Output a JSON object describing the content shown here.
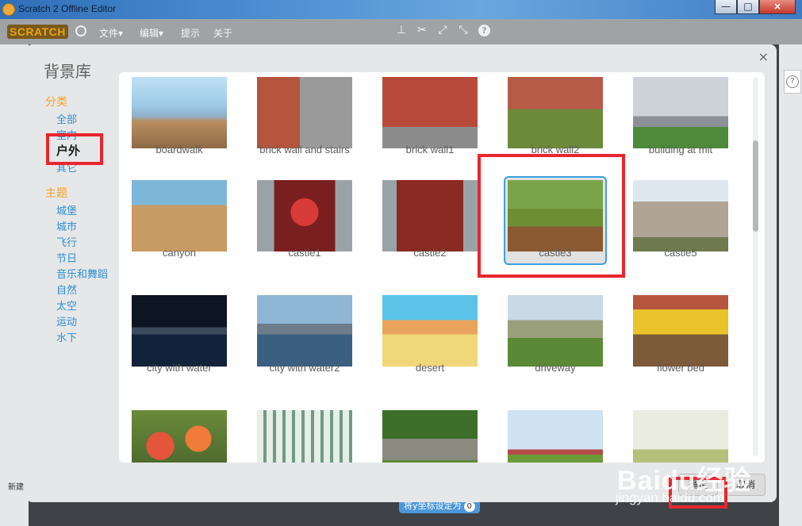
{
  "window": {
    "title": "Scratch 2 Offline Editor",
    "min": "—",
    "max": "□",
    "close": "×"
  },
  "menubar": {
    "logo": "SCRATCH",
    "items": [
      "文件▾",
      "编辑▾",
      "提示",
      "关于"
    ],
    "tools": [
      "duplicate-stamp",
      "delete-scissors",
      "grow",
      "shrink"
    ],
    "help": "?"
  },
  "dialog": {
    "title": "背景库",
    "close": "×",
    "category_header": "分类",
    "categories": [
      "全部",
      "室内",
      "户外",
      "其它"
    ],
    "theme_header": "主题",
    "themes": [
      "城堡",
      "城市",
      "飞行",
      "节日",
      "音乐和舞蹈",
      "自然",
      "太空",
      "运动",
      "水下"
    ],
    "ok": "确定",
    "cancel": "取消",
    "items": [
      {
        "label": "boardwalk"
      },
      {
        "label": "brick wall and stairs"
      },
      {
        "label": "brick wall1"
      },
      {
        "label": "brick wall2"
      },
      {
        "label": "building at mit"
      },
      {
        "label": "canyon"
      },
      {
        "label": "castle1"
      },
      {
        "label": "castle2"
      },
      {
        "label": "castle3"
      },
      {
        "label": "castle5"
      },
      {
        "label": "city with water"
      },
      {
        "label": "city with water2"
      },
      {
        "label": "desert"
      },
      {
        "label": "driveway"
      },
      {
        "label": "flower bed"
      },
      {
        "label": ""
      },
      {
        "label": ""
      },
      {
        "label": ""
      },
      {
        "label": ""
      },
      {
        "label": ""
      }
    ],
    "selected_index": 8
  },
  "editor": {
    "new_label": "新建",
    "block_text": "将y坐标设定为",
    "block_value": "0"
  },
  "watermark": {
    "brand": "Baidu经验",
    "url": "jingyan.baidu.com"
  },
  "colors": {
    "accent": "#3ea0dc",
    "category": "#f5a028",
    "link": "#2f8fd0",
    "highlight": "#e8262e"
  }
}
